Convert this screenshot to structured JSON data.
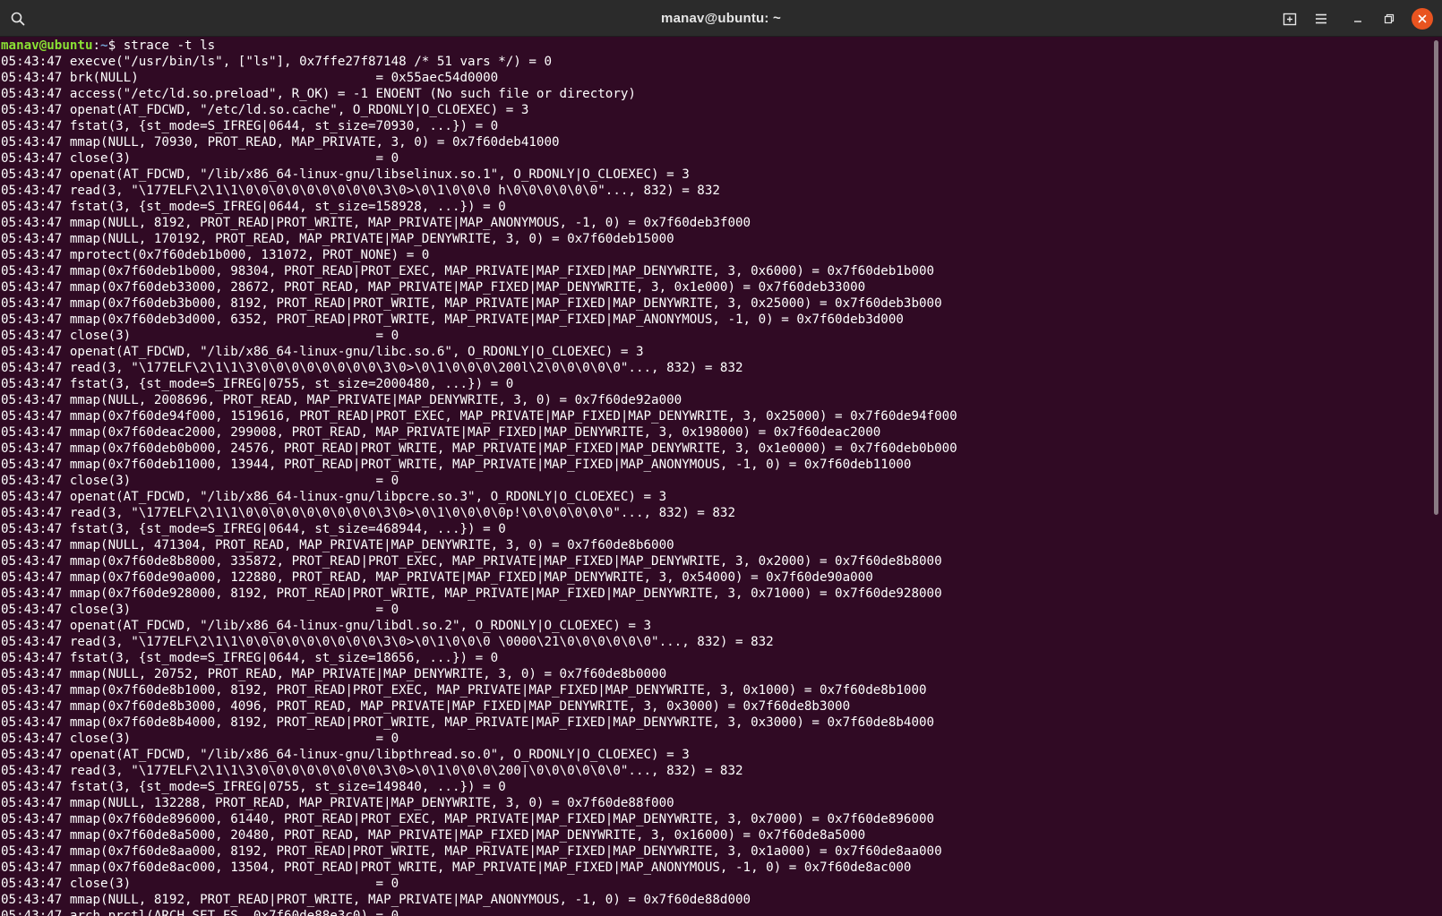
{
  "window": {
    "title": "manav@ubuntu: ~",
    "icons": {
      "search": "search-icon",
      "new_tab": "new-tab-icon",
      "menu": "hamburger-menu-icon",
      "minimize": "minimize-icon",
      "maximize": "maximize-icon",
      "close": "close-icon"
    }
  },
  "colors": {
    "terminal_bg": "#300a24",
    "titlebar_bg": "#2b2b2b",
    "prompt_user": "#8ae234",
    "prompt_path": "#729fcf",
    "close_button": "#e95420"
  },
  "prompt": {
    "user_host": "manav@ubuntu",
    "separator": ":",
    "path": "~",
    "symbol": "$ ",
    "command": "strace -t ls"
  },
  "output": [
    "05:43:47 execve(\"/usr/bin/ls\", [\"ls\"], 0x7ffe27f87148 /* 51 vars */) = 0",
    "05:43:47 brk(NULL)                               = 0x55aec54d0000",
    "05:43:47 access(\"/etc/ld.so.preload\", R_OK) = -1 ENOENT (No such file or directory)",
    "05:43:47 openat(AT_FDCWD, \"/etc/ld.so.cache\", O_RDONLY|O_CLOEXEC) = 3",
    "05:43:47 fstat(3, {st_mode=S_IFREG|0644, st_size=70930, ...}) = 0",
    "05:43:47 mmap(NULL, 70930, PROT_READ, MAP_PRIVATE, 3, 0) = 0x7f60deb41000",
    "05:43:47 close(3)                                = 0",
    "05:43:47 openat(AT_FDCWD, \"/lib/x86_64-linux-gnu/libselinux.so.1\", O_RDONLY|O_CLOEXEC) = 3",
    "05:43:47 read(3, \"\\177ELF\\2\\1\\1\\0\\0\\0\\0\\0\\0\\0\\0\\0\\3\\0>\\0\\1\\0\\0\\0 h\\0\\0\\0\\0\\0\\0\"..., 832) = 832",
    "05:43:47 fstat(3, {st_mode=S_IFREG|0644, st_size=158928, ...}) = 0",
    "05:43:47 mmap(NULL, 8192, PROT_READ|PROT_WRITE, MAP_PRIVATE|MAP_ANONYMOUS, -1, 0) = 0x7f60deb3f000",
    "05:43:47 mmap(NULL, 170192, PROT_READ, MAP_PRIVATE|MAP_DENYWRITE, 3, 0) = 0x7f60deb15000",
    "05:43:47 mprotect(0x7f60deb1b000, 131072, PROT_NONE) = 0",
    "05:43:47 mmap(0x7f60deb1b000, 98304, PROT_READ|PROT_EXEC, MAP_PRIVATE|MAP_FIXED|MAP_DENYWRITE, 3, 0x6000) = 0x7f60deb1b000",
    "05:43:47 mmap(0x7f60deb33000, 28672, PROT_READ, MAP_PRIVATE|MAP_FIXED|MAP_DENYWRITE, 3, 0x1e000) = 0x7f60deb33000",
    "05:43:47 mmap(0x7f60deb3b000, 8192, PROT_READ|PROT_WRITE, MAP_PRIVATE|MAP_FIXED|MAP_DENYWRITE, 3, 0x25000) = 0x7f60deb3b000",
    "05:43:47 mmap(0x7f60deb3d000, 6352, PROT_READ|PROT_WRITE, MAP_PRIVATE|MAP_FIXED|MAP_ANONYMOUS, -1, 0) = 0x7f60deb3d000",
    "05:43:47 close(3)                                = 0",
    "05:43:47 openat(AT_FDCWD, \"/lib/x86_64-linux-gnu/libc.so.6\", O_RDONLY|O_CLOEXEC) = 3",
    "05:43:47 read(3, \"\\177ELF\\2\\1\\1\\3\\0\\0\\0\\0\\0\\0\\0\\0\\3\\0>\\0\\1\\0\\0\\0\\200l\\2\\0\\0\\0\\0\\0\"..., 832) = 832",
    "05:43:47 fstat(3, {st_mode=S_IFREG|0755, st_size=2000480, ...}) = 0",
    "05:43:47 mmap(NULL, 2008696, PROT_READ, MAP_PRIVATE|MAP_DENYWRITE, 3, 0) = 0x7f60de92a000",
    "05:43:47 mmap(0x7f60de94f000, 1519616, PROT_READ|PROT_EXEC, MAP_PRIVATE|MAP_FIXED|MAP_DENYWRITE, 3, 0x25000) = 0x7f60de94f000",
    "05:43:47 mmap(0x7f60deac2000, 299008, PROT_READ, MAP_PRIVATE|MAP_FIXED|MAP_DENYWRITE, 3, 0x198000) = 0x7f60deac2000",
    "05:43:47 mmap(0x7f60deb0b000, 24576, PROT_READ|PROT_WRITE, MAP_PRIVATE|MAP_FIXED|MAP_DENYWRITE, 3, 0x1e0000) = 0x7f60deb0b000",
    "05:43:47 mmap(0x7f60deb11000, 13944, PROT_READ|PROT_WRITE, MAP_PRIVATE|MAP_FIXED|MAP_ANONYMOUS, -1, 0) = 0x7f60deb11000",
    "05:43:47 close(3)                                = 0",
    "05:43:47 openat(AT_FDCWD, \"/lib/x86_64-linux-gnu/libpcre.so.3\", O_RDONLY|O_CLOEXEC) = 3",
    "05:43:47 read(3, \"\\177ELF\\2\\1\\1\\0\\0\\0\\0\\0\\0\\0\\0\\0\\3\\0>\\0\\1\\0\\0\\0\\0p!\\0\\0\\0\\0\\0\\0\"..., 832) = 832",
    "05:43:47 fstat(3, {st_mode=S_IFREG|0644, st_size=468944, ...}) = 0",
    "05:43:47 mmap(NULL, 471304, PROT_READ, MAP_PRIVATE|MAP_DENYWRITE, 3, 0) = 0x7f60de8b6000",
    "05:43:47 mmap(0x7f60de8b8000, 335872, PROT_READ|PROT_EXEC, MAP_PRIVATE|MAP_FIXED|MAP_DENYWRITE, 3, 0x2000) = 0x7f60de8b8000",
    "05:43:47 mmap(0x7f60de90a000, 122880, PROT_READ, MAP_PRIVATE|MAP_FIXED|MAP_DENYWRITE, 3, 0x54000) = 0x7f60de90a000",
    "05:43:47 mmap(0x7f60de928000, 8192, PROT_READ|PROT_WRITE, MAP_PRIVATE|MAP_FIXED|MAP_DENYWRITE, 3, 0x71000) = 0x7f60de928000",
    "05:43:47 close(3)                                = 0",
    "05:43:47 openat(AT_FDCWD, \"/lib/x86_64-linux-gnu/libdl.so.2\", O_RDONLY|O_CLOEXEC) = 3",
    "05:43:47 read(3, \"\\177ELF\\2\\1\\1\\0\\0\\0\\0\\0\\0\\0\\0\\0\\3\\0>\\0\\1\\0\\0\\0 \\0000\\21\\0\\0\\0\\0\\0\\0\"..., 832) = 832",
    "05:43:47 fstat(3, {st_mode=S_IFREG|0644, st_size=18656, ...}) = 0",
    "05:43:47 mmap(NULL, 20752, PROT_READ, MAP_PRIVATE|MAP_DENYWRITE, 3, 0) = 0x7f60de8b0000",
    "05:43:47 mmap(0x7f60de8b1000, 8192, PROT_READ|PROT_EXEC, MAP_PRIVATE|MAP_FIXED|MAP_DENYWRITE, 3, 0x1000) = 0x7f60de8b1000",
    "05:43:47 mmap(0x7f60de8b3000, 4096, PROT_READ, MAP_PRIVATE|MAP_FIXED|MAP_DENYWRITE, 3, 0x3000) = 0x7f60de8b3000",
    "05:43:47 mmap(0x7f60de8b4000, 8192, PROT_READ|PROT_WRITE, MAP_PRIVATE|MAP_FIXED|MAP_DENYWRITE, 3, 0x3000) = 0x7f60de8b4000",
    "05:43:47 close(3)                                = 0",
    "05:43:47 openat(AT_FDCWD, \"/lib/x86_64-linux-gnu/libpthread.so.0\", O_RDONLY|O_CLOEXEC) = 3",
    "05:43:47 read(3, \"\\177ELF\\2\\1\\1\\3\\0\\0\\0\\0\\0\\0\\0\\0\\3\\0>\\0\\1\\0\\0\\0\\200|\\0\\0\\0\\0\\0\\0\"..., 832) = 832",
    "05:43:47 fstat(3, {st_mode=S_IFREG|0755, st_size=149840, ...}) = 0",
    "05:43:47 mmap(NULL, 132288, PROT_READ, MAP_PRIVATE|MAP_DENYWRITE, 3, 0) = 0x7f60de88f000",
    "05:43:47 mmap(0x7f60de896000, 61440, PROT_READ|PROT_EXEC, MAP_PRIVATE|MAP_FIXED|MAP_DENYWRITE, 3, 0x7000) = 0x7f60de896000",
    "05:43:47 mmap(0x7f60de8a5000, 20480, PROT_READ, MAP_PRIVATE|MAP_FIXED|MAP_DENYWRITE, 3, 0x16000) = 0x7f60de8a5000",
    "05:43:47 mmap(0x7f60de8aa000, 8192, PROT_READ|PROT_WRITE, MAP_PRIVATE|MAP_FIXED|MAP_DENYWRITE, 3, 0x1a000) = 0x7f60de8aa000",
    "05:43:47 mmap(0x7f60de8ac000, 13504, PROT_READ|PROT_WRITE, MAP_PRIVATE|MAP_FIXED|MAP_ANONYMOUS, -1, 0) = 0x7f60de8ac000",
    "05:43:47 close(3)                                = 0",
    "05:43:47 mmap(NULL, 8192, PROT_READ|PROT_WRITE, MAP_PRIVATE|MAP_ANONYMOUS, -1, 0) = 0x7f60de88d000",
    "05:43:47 arch_prctl(ARCH_SET_FS, 0x7f60de88e3c0) = 0"
  ]
}
